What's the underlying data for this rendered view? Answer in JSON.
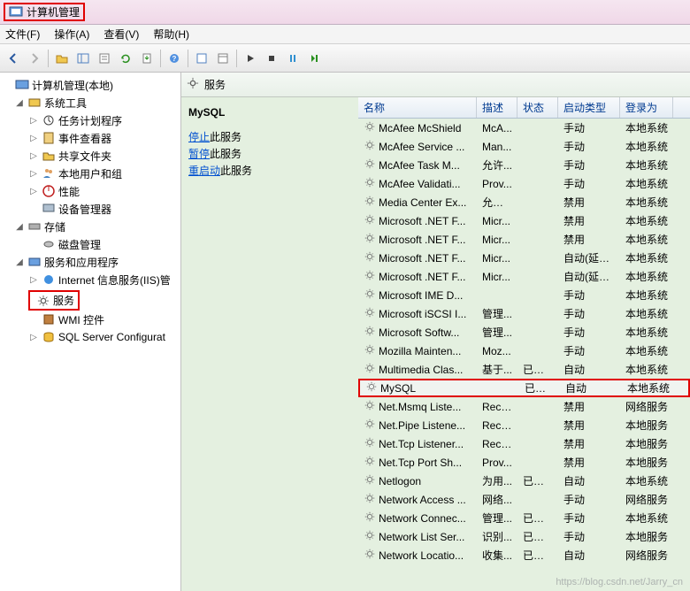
{
  "titlebar": {
    "title": "计算机管理"
  },
  "menubar": {
    "file": "文件(F)",
    "action": "操作(A)",
    "view": "查看(V)",
    "help": "帮助(H)"
  },
  "tree": {
    "root": "计算机管理(本地)",
    "systools": "系统工具",
    "task": "任务计划程序",
    "event": "事件查看器",
    "shared": "共享文件夹",
    "users": "本地用户和组",
    "perf": "性能",
    "devmgr": "设备管理器",
    "storage": "存储",
    "diskmgmt": "磁盘管理",
    "apps": "服务和应用程序",
    "iis": "Internet 信息服务(IIS)管",
    "services": "服务",
    "wmi": "WMI 控件",
    "sqlcfg": "SQL Server Configurat"
  },
  "content": {
    "header": "服务",
    "selected_service": "MySQL",
    "actions": {
      "stop_link": "停止",
      "stop_suffix": "此服务",
      "pause_link": "暂停",
      "pause_suffix": "此服务",
      "restart_link": "重启动",
      "restart_suffix": "此服务"
    },
    "columns": {
      "name": "名称",
      "desc": "描述",
      "status": "状态",
      "start": "启动类型",
      "logon": "登录为"
    },
    "rows": [
      {
        "name": "McAfee McShield",
        "desc": "McA...",
        "status": "",
        "start": "手动",
        "logon": "本地系统"
      },
      {
        "name": "McAfee Service ...",
        "desc": "Man...",
        "status": "",
        "start": "手动",
        "logon": "本地系统"
      },
      {
        "name": "McAfee Task M...",
        "desc": "允许...",
        "status": "",
        "start": "手动",
        "logon": "本地系统"
      },
      {
        "name": "McAfee Validati...",
        "desc": "Prov...",
        "status": "",
        "start": "手动",
        "logon": "本地系统"
      },
      {
        "name": "Media Center Ex...",
        "desc": "允许 ...",
        "status": "",
        "start": "禁用",
        "logon": "本地系统"
      },
      {
        "name": "Microsoft .NET F...",
        "desc": "Micr...",
        "status": "",
        "start": "禁用",
        "logon": "本地系统"
      },
      {
        "name": "Microsoft .NET F...",
        "desc": "Micr...",
        "status": "",
        "start": "禁用",
        "logon": "本地系统"
      },
      {
        "name": "Microsoft .NET F...",
        "desc": "Micr...",
        "status": "",
        "start": "自动(延迟...",
        "logon": "本地系统"
      },
      {
        "name": "Microsoft .NET F...",
        "desc": "Micr...",
        "status": "",
        "start": "自动(延迟...",
        "logon": "本地系统"
      },
      {
        "name": "Microsoft IME D...",
        "desc": "",
        "status": "",
        "start": "手动",
        "logon": "本地系统"
      },
      {
        "name": "Microsoft iSCSI I...",
        "desc": "管理...",
        "status": "",
        "start": "手动",
        "logon": "本地系统"
      },
      {
        "name": "Microsoft Softw...",
        "desc": "管理...",
        "status": "",
        "start": "手动",
        "logon": "本地系统"
      },
      {
        "name": "Mozilla Mainten...",
        "desc": "Moz...",
        "status": "",
        "start": "手动",
        "logon": "本地系统"
      },
      {
        "name": "Multimedia Clas...",
        "desc": "基于...",
        "status": "已启动",
        "start": "自动",
        "logon": "本地系统"
      },
      {
        "name": "MySQL",
        "desc": "",
        "status": "已启动",
        "start": "自动",
        "logon": "本地系统",
        "highlight": true
      },
      {
        "name": "Net.Msmq Liste...",
        "desc": "Rece...",
        "status": "",
        "start": "禁用",
        "logon": "网络服务"
      },
      {
        "name": "Net.Pipe Listene...",
        "desc": "Rece...",
        "status": "",
        "start": "禁用",
        "logon": "本地服务"
      },
      {
        "name": "Net.Tcp Listener...",
        "desc": "Rece...",
        "status": "",
        "start": "禁用",
        "logon": "本地服务"
      },
      {
        "name": "Net.Tcp Port Sh...",
        "desc": "Prov...",
        "status": "",
        "start": "禁用",
        "logon": "本地服务"
      },
      {
        "name": "Netlogon",
        "desc": "为用...",
        "status": "已启动",
        "start": "自动",
        "logon": "本地系统"
      },
      {
        "name": "Network Access ...",
        "desc": "网络...",
        "status": "",
        "start": "手动",
        "logon": "网络服务"
      },
      {
        "name": "Network Connec...",
        "desc": "管理...",
        "status": "已启动",
        "start": "手动",
        "logon": "本地系统"
      },
      {
        "name": "Network List Ser...",
        "desc": "识别...",
        "status": "已启动",
        "start": "手动",
        "logon": "本地服务"
      },
      {
        "name": "Network Locatio...",
        "desc": "收集...",
        "status": "已启动",
        "start": "自动",
        "logon": "网络服务"
      }
    ]
  },
  "watermark": "https://blog.csdn.net/Jarry_cn"
}
